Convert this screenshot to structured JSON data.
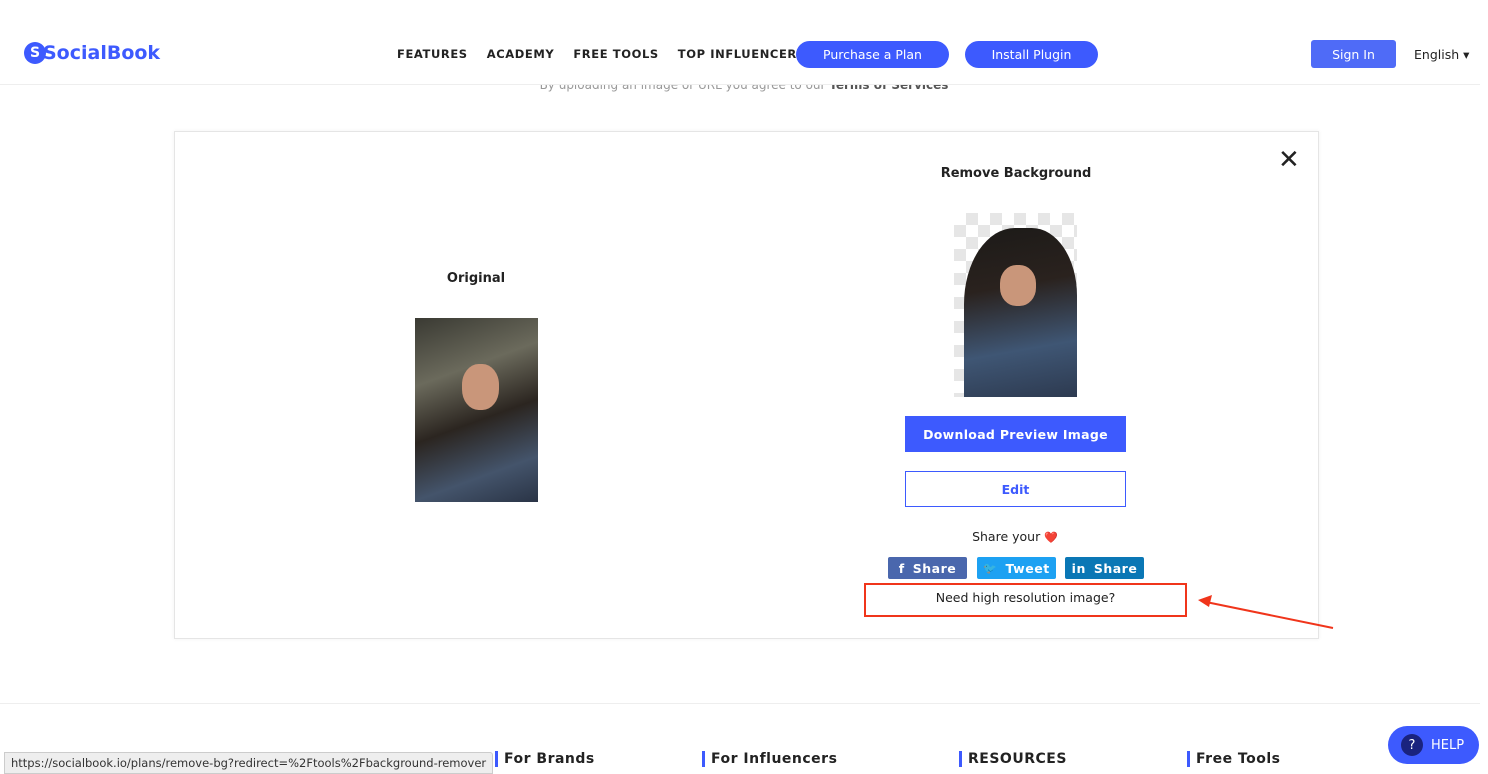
{
  "header": {
    "logo": "SocialBook",
    "logo_mark": "S",
    "nav": [
      "FEATURES",
      "ACADEMY",
      "FREE TOOLS",
      "TOP INFLUENCERS"
    ],
    "purchase": "Purchase a Plan",
    "install": "Install Plugin",
    "signin": "Sign In",
    "language": "English ▾"
  },
  "agree": {
    "text": "By uploading an image or URL you agree to our",
    "link": "Terms of Services"
  },
  "card": {
    "close": "✕",
    "original_label": "Original",
    "result_label": "Remove Background",
    "download": "Download Preview Image",
    "edit": "Edit",
    "share_your": "Share your",
    "heart": "❤️",
    "share_buttons": [
      {
        "icon": "f",
        "label": "Share",
        "color": "#3b5998"
      },
      {
        "icon": "🐦",
        "label": "Tweet",
        "color": "#1da1f2"
      },
      {
        "icon": "in",
        "label": "Share",
        "color": "#0077b5"
      }
    ],
    "hires": "Need high resolution image?"
  },
  "annotation": {
    "color": "#f0351b"
  },
  "footer": {
    "headings": [
      "For Brands",
      "For Influencers",
      "RESOURCES",
      "Free Tools"
    ]
  },
  "status_url": "https://socialbook.io/plans/remove-bg?redirect=%2Ftools%2Fbackground-remover",
  "help": {
    "icon": "?",
    "label": "HELP"
  },
  "colors": {
    "accent": "#3d5afe"
  }
}
